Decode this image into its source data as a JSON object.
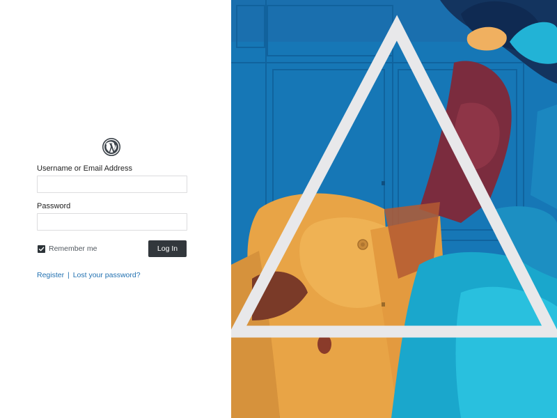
{
  "login": {
    "logo_icon": "wordpress-logo",
    "username_label": "Username or Email Address",
    "username_value": "",
    "password_label": "Password",
    "password_value": "",
    "remember_label": "Remember me",
    "remember_checked": true,
    "login_button_label": "Log In",
    "register_link": "Register",
    "link_separator": "|",
    "lost_password_link": "Lost your password?"
  },
  "background_image": {
    "subject": "painted mural of a figure with a white triangle on blue doors"
  },
  "colors": {
    "button": "#32373c",
    "link": "#2271b1",
    "checkbox": "#2c3338",
    "mural_blue": "#1479b9"
  }
}
